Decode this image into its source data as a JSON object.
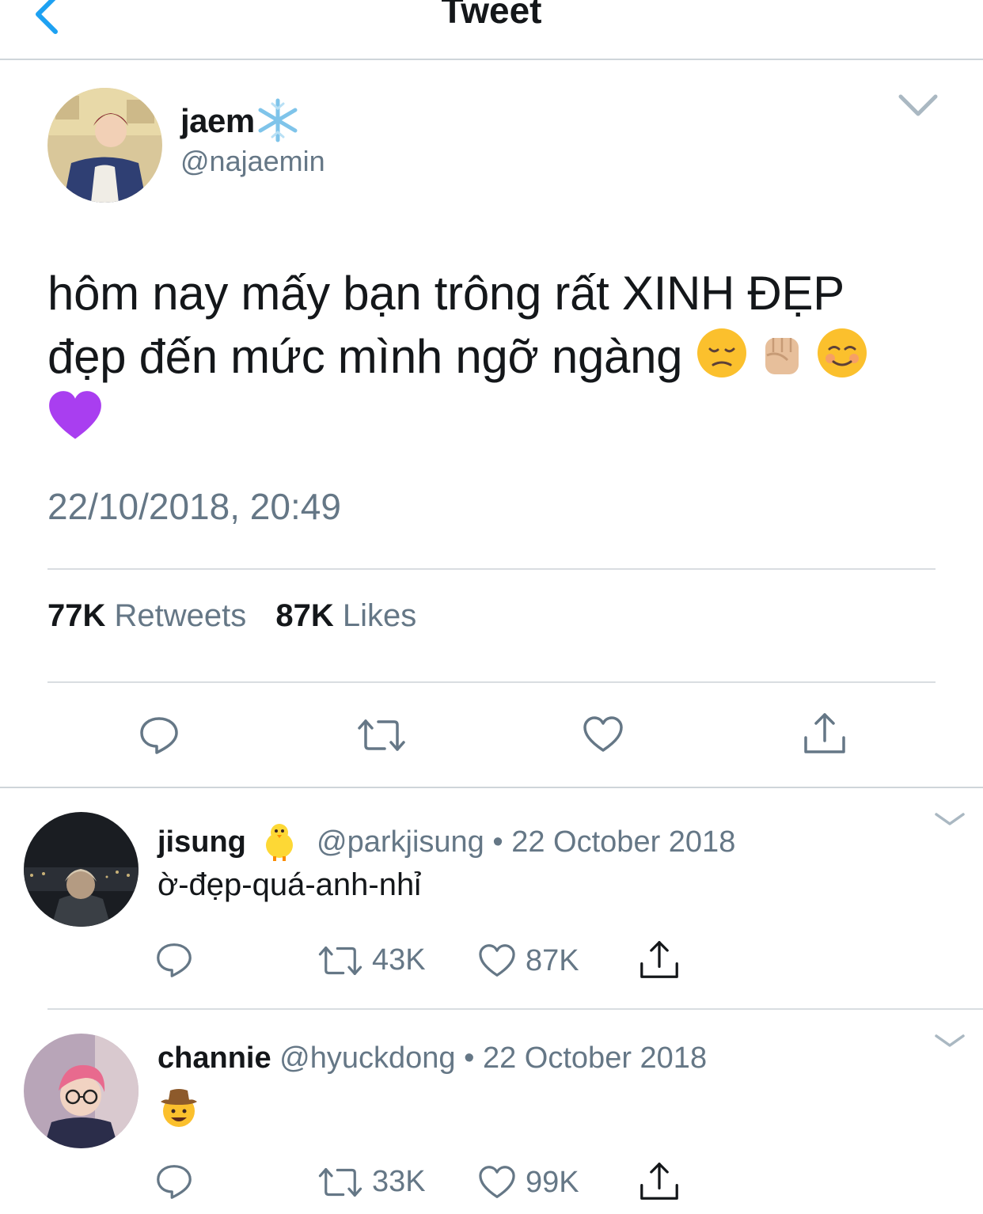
{
  "nav": {
    "title": "Tweet"
  },
  "tweet": {
    "display_name": "jaem",
    "name_emoji": "snowflake",
    "handle": "@najaemin",
    "text_line1": "hôm nay mấy bạn trông rất XINH ĐẸP",
    "text_line2": "đẹp đến mức mình ngỡ ngàng",
    "emojis": [
      "disappointed-face",
      "raised-fist",
      "smiling-face",
      "purple-heart"
    ],
    "timestamp": "22/10/2018, 20:49",
    "retweets_count": "77K",
    "retweets_label": "Retweets",
    "likes_count": "87K",
    "likes_label": "Likes"
  },
  "replies": [
    {
      "name": "jisung",
      "name_emoji": "baby-chick",
      "handle": "@parkjisung",
      "date": "• 22 October 2018",
      "text": "ờ-đẹp-quá-anh-nhỉ",
      "retweets": "43K",
      "likes": "87K"
    },
    {
      "name": "channie",
      "handle": "@hyuckdong",
      "date": "• 22 October 2018",
      "body_emoji": "cowboy-face",
      "retweets": "33K",
      "likes": "99K"
    }
  ],
  "colors": {
    "accent": "#1da1f2",
    "secondary_text": "#657786",
    "divider": "#d9dde1"
  }
}
